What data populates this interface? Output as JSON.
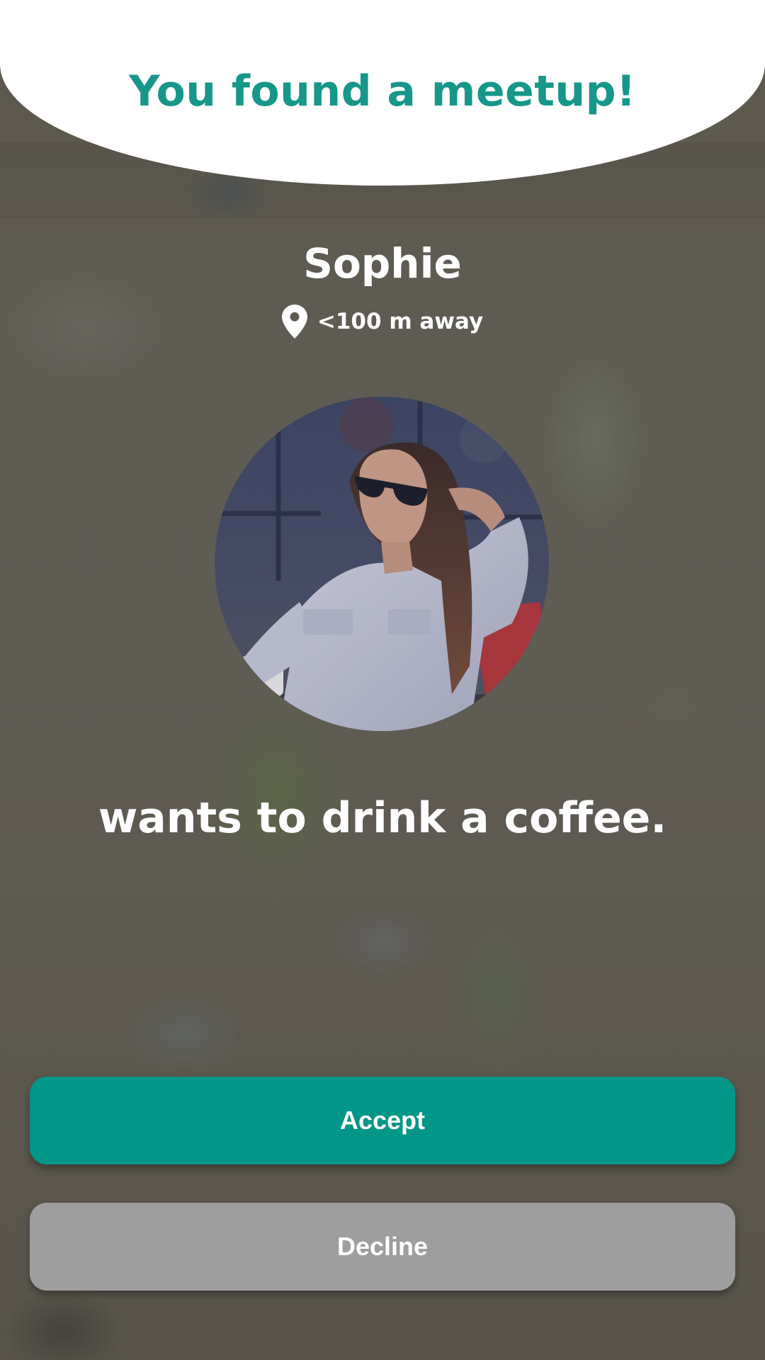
{
  "header": {
    "title": "You found a meetup!"
  },
  "match": {
    "name": "Sophie",
    "distance": "<100 m away",
    "location_icon": "location-pin-icon",
    "avatar": "profile-photo",
    "activity_text": "wants to drink a coffee."
  },
  "actions": {
    "accept_label": "Accept",
    "decline_label": "Decline"
  },
  "colors": {
    "accent": "#009688",
    "title": "#16978A",
    "decline": "#9E9E9E",
    "background": "#5B574D",
    "header": "#FFFFFF",
    "text_on_dark": "#FFFFFF"
  }
}
